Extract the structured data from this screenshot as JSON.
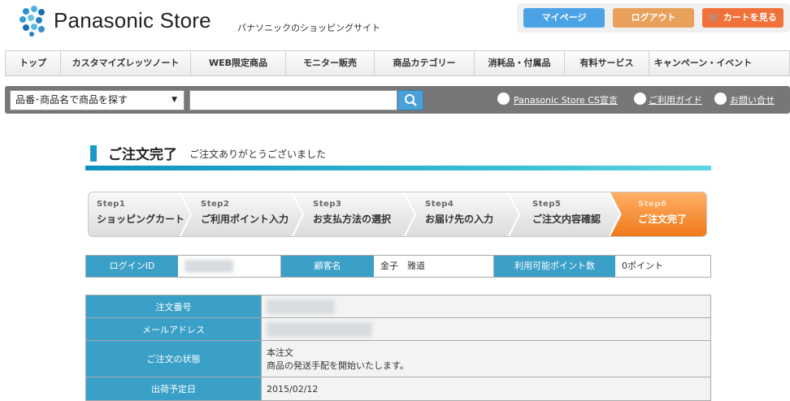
{
  "header": {
    "logo_text": "Panasonic Store",
    "logo_sub": "パナソニックのショッピングサイト",
    "buttons": {
      "mypage": "マイページ",
      "logout": "ログアウト",
      "cart": "カートを見る"
    }
  },
  "nav": {
    "items": [
      "トップ",
      "カスタマイズレッツノート",
      "WEB限定商品",
      "モニター販売",
      "商品カテゴリー",
      "消耗品・付属品",
      "有料サービス",
      "キャンペーン・イベント"
    ]
  },
  "search": {
    "select_value": "品番･商品名で商品を探す",
    "placeholder": "",
    "links": [
      "Panasonic Store CS宣言",
      "ご利用ガイド",
      "お問い合せ"
    ]
  },
  "page": {
    "title": "ご注文完了",
    "subtitle": "ご注文ありがとうございました"
  },
  "steps": [
    {
      "num": "Step1",
      "label": "ショッピングカート"
    },
    {
      "num": "Step2",
      "label": "ご利用ポイント入力"
    },
    {
      "num": "Step3",
      "label": "お支払方法の選択"
    },
    {
      "num": "Step4",
      "label": "お届け先の入力"
    },
    {
      "num": "Step5",
      "label": "ご注文内容確認"
    },
    {
      "num": "Step6",
      "label": "ご注文完了"
    }
  ],
  "info": {
    "login_id_label": "ログインID",
    "customer_label": "顧客名",
    "customer_value": "金子　雅道",
    "points_label": "利用可能ポイント数",
    "points_value": "0ポイント"
  },
  "order": {
    "rows": [
      {
        "label": "注文番号"
      },
      {
        "label": "メールアドレス"
      },
      {
        "label": "ご注文の状態",
        "line1": "本注文",
        "line2": "商品の発送手配を開始いたします。"
      },
      {
        "label": "出荷予定日",
        "value": "2015/02/12"
      }
    ]
  },
  "colors": {
    "accent": "#3aa0c8",
    "active_step": "#f07a1a",
    "mypage": "#4ba3e6",
    "logout": "#e8a05b",
    "cart": "#f0713a"
  }
}
